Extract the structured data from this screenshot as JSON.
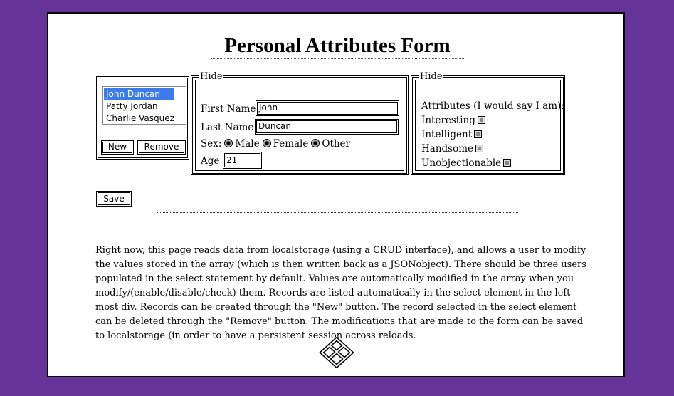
{
  "page": {
    "title": "Personal Attributes Form"
  },
  "users": {
    "options": [
      "John Duncan",
      "Patty Jordan",
      "Charlie Vasquez"
    ],
    "selected": "John Duncan",
    "new_label": "New",
    "remove_label": "Remove"
  },
  "personal": {
    "legend": "Hide",
    "first_name_label": "First Name",
    "first_name_value": "John",
    "last_name_label": "Last Name",
    "last_name_value": "Duncan",
    "sex_label": "Sex:",
    "sex_options": [
      "Male",
      "Female",
      "Other"
    ],
    "age_label": "Age",
    "age_value": "21"
  },
  "attributes": {
    "legend": "Hide",
    "heading": "Attributes (I would say I am):",
    "items": [
      "Interesting",
      "Intelligent",
      "Handsome",
      "Unobjectionable"
    ]
  },
  "save_label": "Save",
  "description": "Right now, this page reads data from localstorage (using a CRUD interface), and allows a user to modify the values stored in the array (which is then written back as a JSONobject). There should be three users populated in the select statement by default. Values are automatically modified in the array when you modify/(enable/disable/check) them. Records are listed automatically in the select element in the left-most div. Records can be created through the \"New\" button. The record selected in the select element can be deleted through the \"Remove\" button. The modifications that are made to the form can be saved to localstorage (in order to have a persistent session across reloads."
}
